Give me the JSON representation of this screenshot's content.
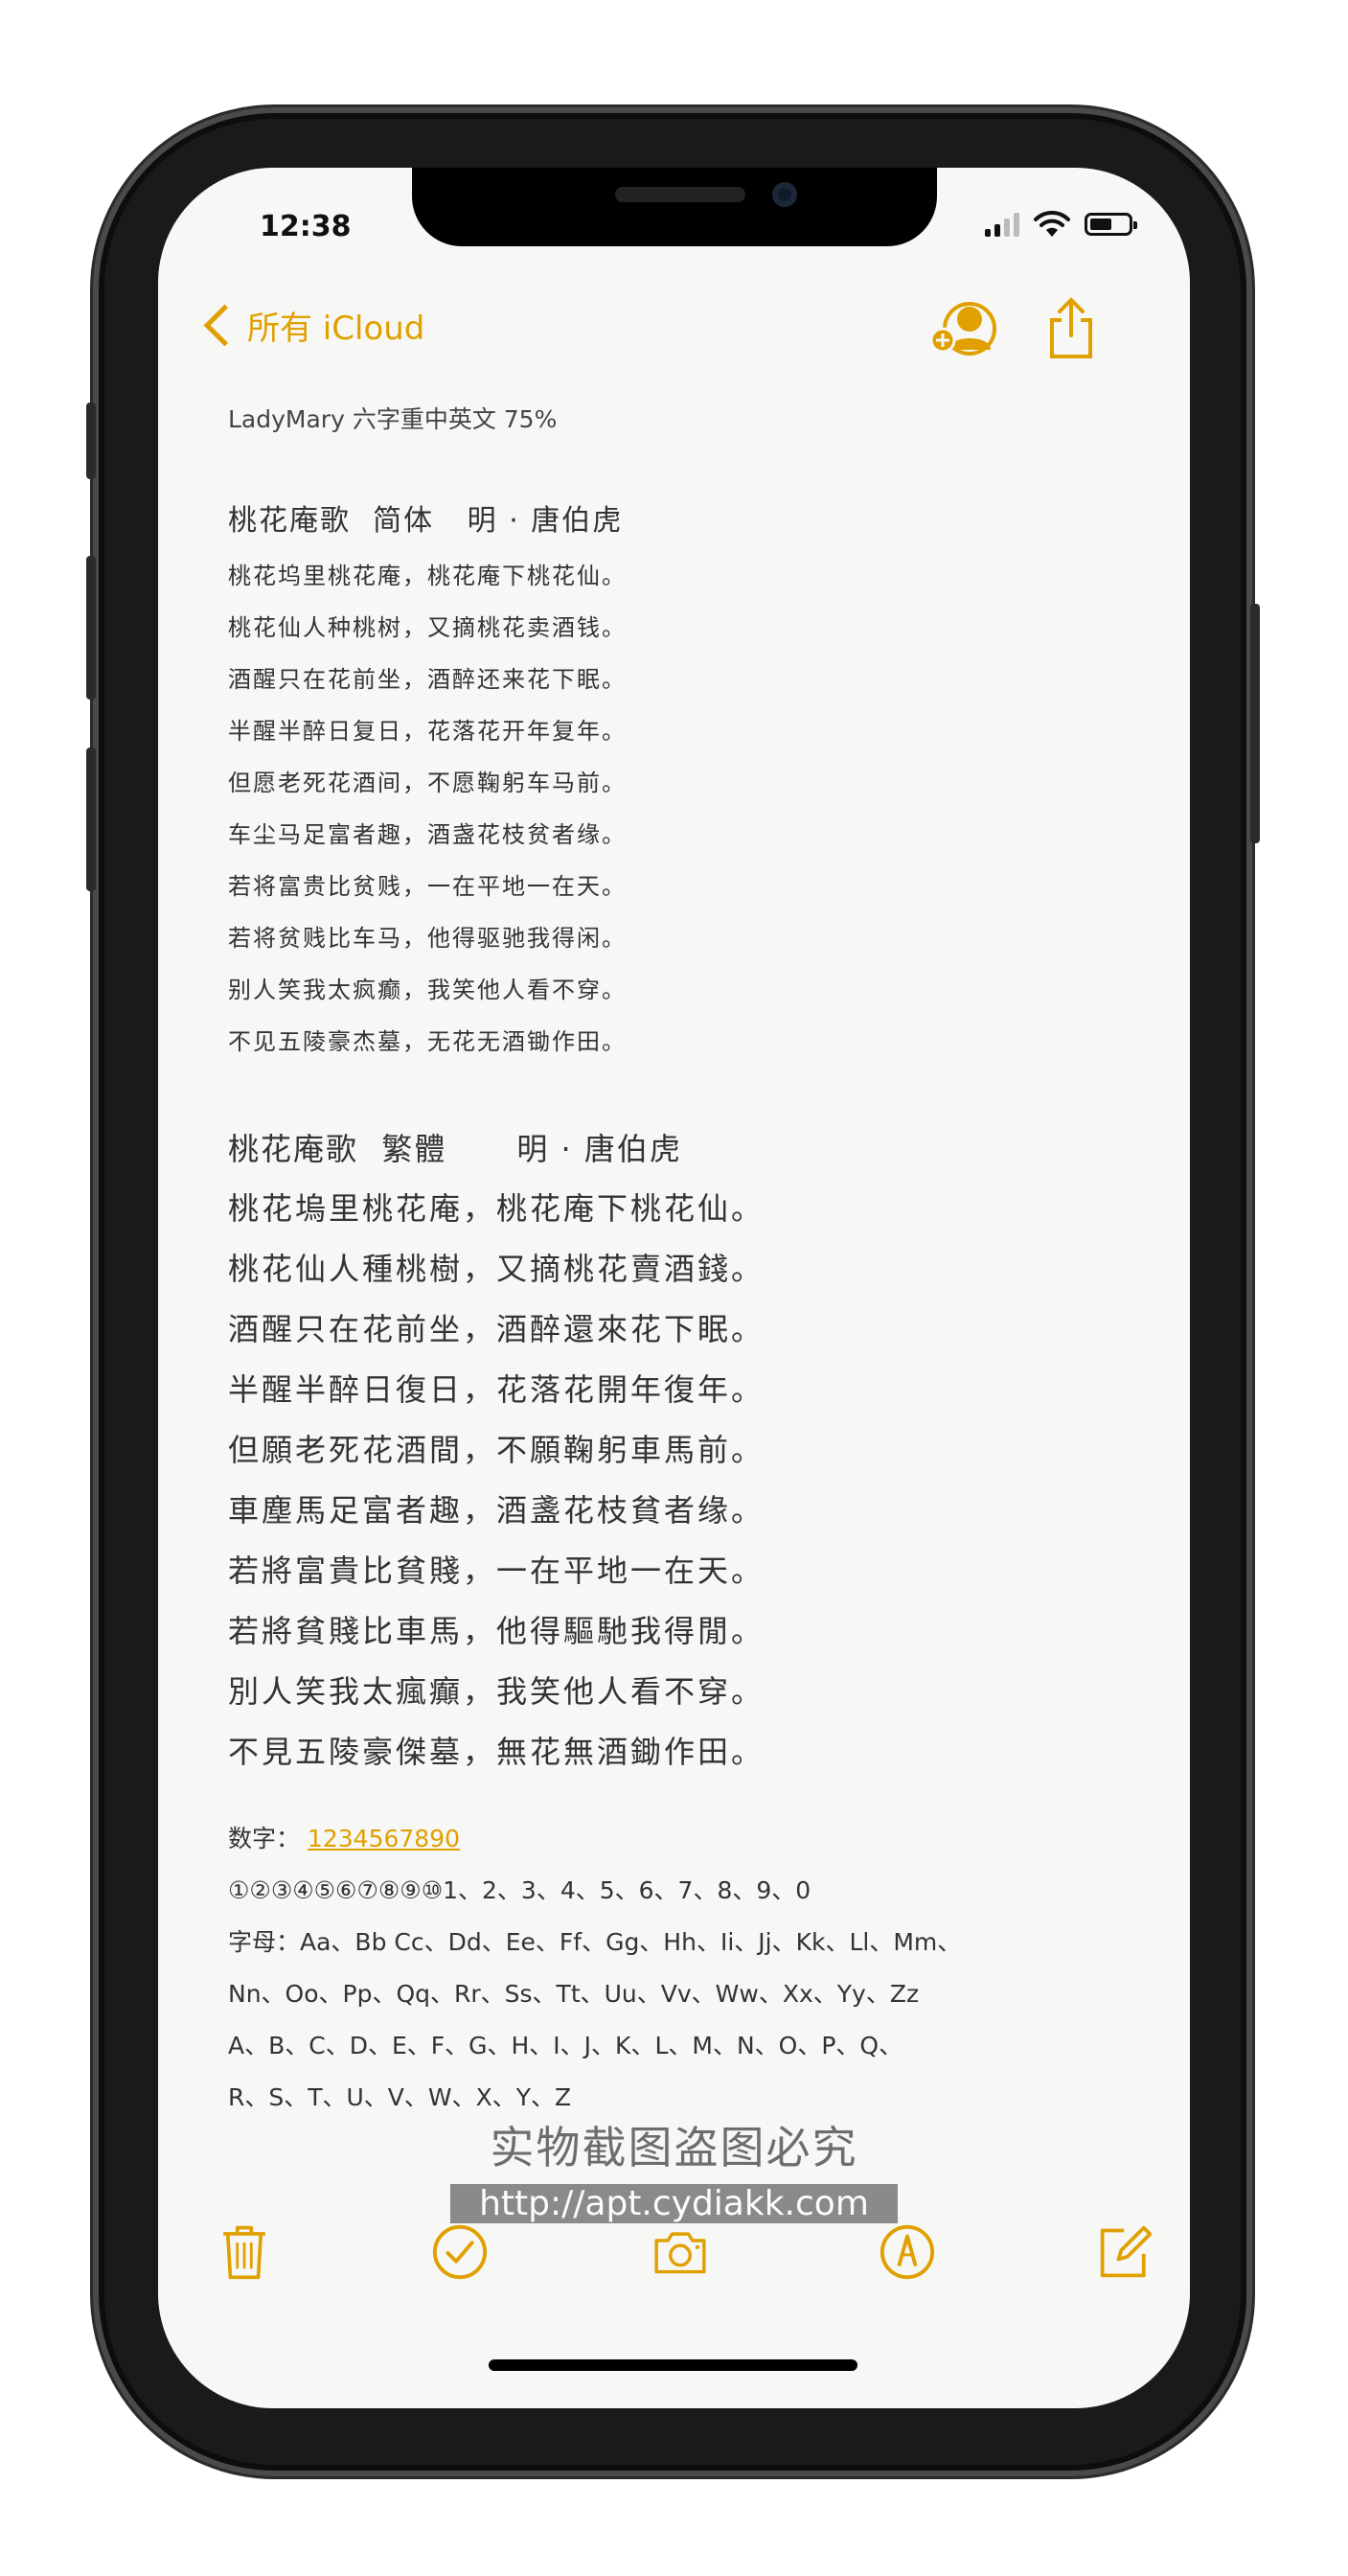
{
  "status_bar": {
    "time": "12:38"
  },
  "nav": {
    "back_label": "所有 iCloud"
  },
  "note": {
    "meta": "LadyMary 六字重中英文 75%",
    "simplified": {
      "title": "桃花庵歌  简体   明 · 唐伯虎",
      "lines": [
        "桃花坞里桃花庵，桃花庵下桃花仙。",
        "桃花仙人种桃树，又摘桃花卖酒钱。",
        "酒醒只在花前坐，酒醉还来花下眠。",
        "半醒半醉日复日，花落花开年复年。",
        "但愿老死花酒间，不愿鞠躬车马前。",
        "车尘马足富者趣，酒盏花枝贫者缘。",
        "若将富贵比贫贱，一在平地一在天。",
        "若将贫贱比车马，他得驱驰我得闲。",
        "别人笑我太疯癫，我笑他人看不穿。",
        "不见五陵豪杰墓，无花无酒锄作田。"
      ]
    },
    "traditional": {
      "title": "桃花庵歌  繁體      明 · 唐伯虎",
      "lines": [
        "桃花塢里桃花庵，桃花庵下桃花仙。",
        "桃花仙人種桃樹，又摘桃花賣酒錢。",
        "酒醒只在花前坐，酒醉還來花下眠。",
        "半醒半醉日復日，花落花開年復年。",
        "但願老死花酒間，不願鞠躬車馬前。",
        "車塵馬足富者趣，酒盞花枝貧者缘。",
        "若將富貴比貧賤，一在平地一在天。",
        "若將貧賤比車馬，他得驅馳我得閒。",
        "別人笑我太瘋癲，我笑他人看不穿。",
        "不見五陵豪傑墓，無花無酒鋤作田。"
      ]
    },
    "numbers_label": "数字：",
    "numbers_link": "1234567890",
    "numbers_line": "①②③④⑤⑥⑦⑧⑨⑩1、2、3、4、5、6、7、8、9、0",
    "letters_line1": "字母：Aa、Bb Cc、Dd、Ee、Ff、Gg、Hh、Ii、Jj、Kk、Ll、Mm、",
    "letters_line2": "Nn、Oo、Pp、Qq、Rr、Ss、Tt、Uu、Vv、Ww、Xx、Yy、Zz",
    "letters_line3": "A、B、C、D、E、F、G、H、I、J、K、L、M、N、O、P、Q、",
    "letters_line4": "R、S、T、U、V、W、X、Y、Z"
  },
  "watermark": {
    "line1": "实物截图盗图必究",
    "line2": "http://apt.cydiakk.com"
  },
  "colors": {
    "accent": "#e0a000",
    "paper": "#f7f7f5",
    "text": "#333333"
  },
  "icons": {
    "add_person": "person-plus-icon",
    "share": "share-icon",
    "trash": "trash-icon",
    "checklist": "checkmark-circle-icon",
    "camera": "camera-icon",
    "markup": "pen-circle-icon",
    "compose": "compose-icon"
  }
}
